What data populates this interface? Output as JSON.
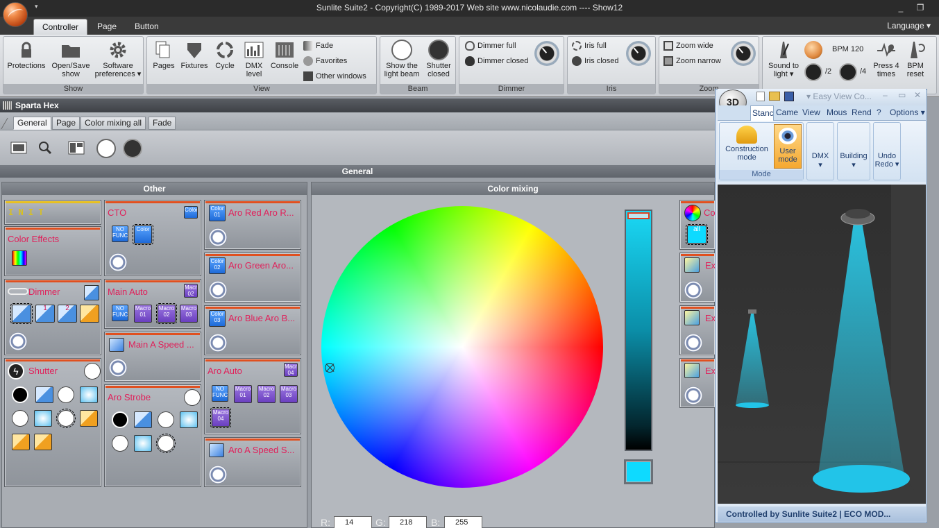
{
  "window": {
    "title": "Sunlite Suite2 - Copyright(C) 1989-2017   Web site www.nicolaudie.com ---- Show12"
  },
  "ribbon": {
    "tabs": [
      "Controller",
      "Page",
      "Button"
    ],
    "language": "Language",
    "groups": {
      "show": {
        "label": "Show",
        "protections": "Protections",
        "open_save_1": "Open/Save",
        "open_save_2": "show",
        "software_1": "Software",
        "software_2": "preferences"
      },
      "view": {
        "label": "View",
        "pages": "Pages",
        "fixtures": "Fixtures",
        "cycle": "Cycle",
        "dmx_1": "DMX",
        "dmx_2": "level",
        "console": "Console",
        "fade": "Fade",
        "favorites": "Favorites",
        "other_windows": "Other windows"
      },
      "beam": {
        "label": "Beam",
        "show_1": "Show the",
        "show_2": "light beam",
        "shutter_1": "Shutter",
        "shutter_2": "closed"
      },
      "dimmer": {
        "label": "Dimmer",
        "full": "Dimmer full",
        "closed": "Dimmer closed"
      },
      "iris": {
        "label": "Iris",
        "full": "Iris full",
        "closed": "Iris closed"
      },
      "zoom": {
        "label": "Zoom",
        "wide": "Zoom wide",
        "narrow": "Zoom narrow"
      },
      "music": {
        "sound_1": "Sound to",
        "sound_2": "light",
        "bpm": "BPM 120",
        "div2": "/2",
        "div4": "/4",
        "press_1": "Press 4",
        "press_2": "times",
        "reset_1": "BPM",
        "reset_2": "reset"
      }
    }
  },
  "fixture": {
    "name": "Sparta Hex"
  },
  "subtabs": [
    "General",
    "Page",
    "Color mixing all",
    "Fade"
  ],
  "general_header": "General",
  "other_panel": {
    "header": "Other",
    "init": "I N I T",
    "color_effects": "Color Effects",
    "dimmer": "Dimmer",
    "shutter": "Shutter",
    "cto": "CTO",
    "main_auto": "Main Auto",
    "main_a_speed": "Main A Speed ...",
    "aro_strobe": "Aro Strobe",
    "aro_red": "Aro Red Aro R...",
    "aro_green": "Aro Green Aro...",
    "aro_blue": "Aro Blue Aro B...",
    "aro_auto": "Aro Auto",
    "aro_a_speed": "Aro A Speed S...",
    "color_lbl": "Color",
    "no_func": "NO FUNC.",
    "macro01": "Macro 01",
    "macro02": "Macro 02",
    "macro03": "Macro 03",
    "macro04": "Macro 04",
    "color01": "Color 01",
    "color02": "Color 02",
    "color03": "Color 03",
    "badge02": "Macro 02",
    "badge04": "Macro 04",
    "num1": "1",
    "num2": "2"
  },
  "color_mixing": {
    "header": "Color mixing",
    "r_label": "R:",
    "r": "14",
    "g_label": "G:",
    "g": "218",
    "b_label": "B:",
    "b": "255",
    "current_color": "#0edaff",
    "right_cells": {
      "cell1": "Co",
      "cell1_all": "all",
      "ex": "Ex"
    }
  },
  "easyview": {
    "title": "Easy View   Co...",
    "tabs": [
      "Stanc",
      "Came",
      "View",
      "Mous",
      "Rend",
      "?",
      "Options"
    ],
    "badge": "3D",
    "construction_1": "Construction",
    "construction_2": "mode",
    "user_1": "User",
    "user_2": "mode",
    "dmx": "DMX",
    "building": "Building",
    "undo_1": "Undo",
    "undo_2": "Redo",
    "group_label": "Mode",
    "status": "Controlled by Sunlite Suite2   |   ECO MOD..."
  },
  "colors": {
    "accent": "#e0205a",
    "beam": "#2ad0f0",
    "ribbon_bg": "#d6d9dd"
  }
}
